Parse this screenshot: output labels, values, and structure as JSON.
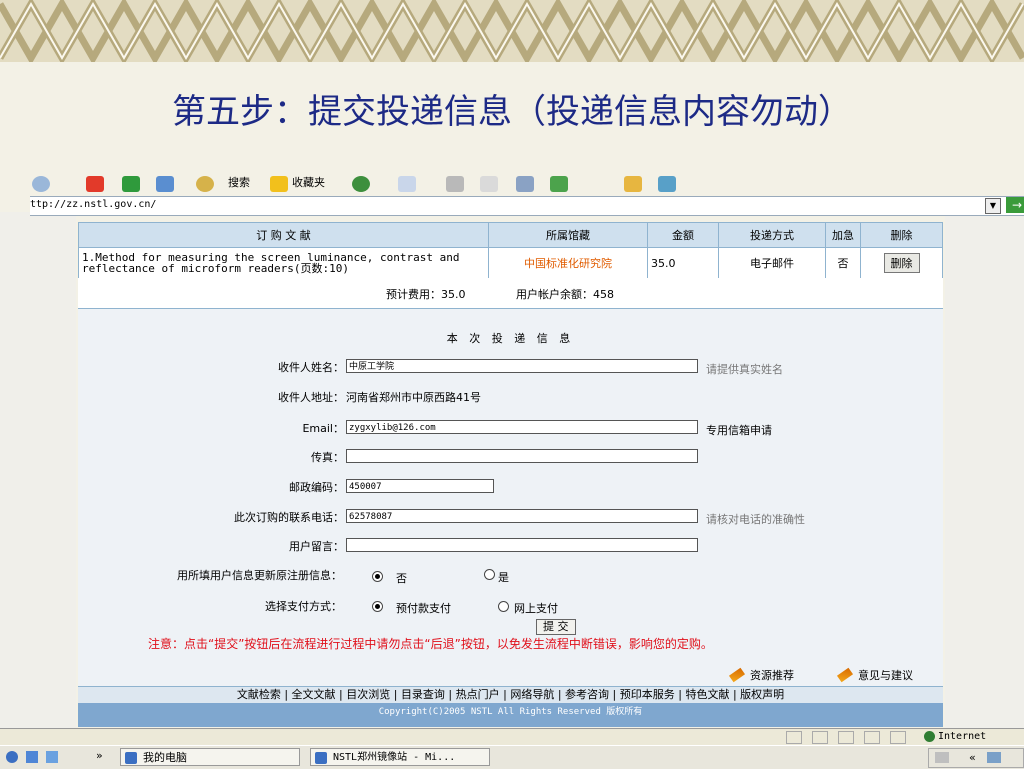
{
  "slide": {
    "title": "第五步：提交投递信息（投递信息内容勿动）"
  },
  "browser": {
    "toolbar": {
      "search": "搜索",
      "favorites": "收藏夹"
    },
    "address": "ttp://zz.nstl.gov.cn/",
    "go_label": "→"
  },
  "order_table": {
    "headers": [
      "订 购 文 献",
      "所属馆藏",
      "金额",
      "投递方式",
      "加急",
      "删除"
    ],
    "row": {
      "title_line1": "1.Method for measuring the screen luminance, contrast and",
      "title_line2": "reflectance of microform readers(页数:10)",
      "library": "中国标准化研究院",
      "amount": "35.0",
      "delivery": "电子邮件",
      "urgent": "否",
      "delete_label": "删除"
    },
    "estimated_cost": "预计费用：35.0",
    "balance": "用户帐户余额：458"
  },
  "delivery_info": {
    "section_title": "本 次 投 递 信 息",
    "recipient_name": {
      "label": "收件人姓名：",
      "value": "中原工学院",
      "hint": "请提供真实姓名"
    },
    "recipient_address": {
      "label": "收件人地址：",
      "value": "河南省郑州市中原西路41号"
    },
    "email": {
      "label": "Email：",
      "value": "zygxylib@126.com",
      "hint": "专用信箱申请"
    },
    "fax": {
      "label": "传真：",
      "value": ""
    },
    "postal_code": {
      "label": "邮政编码：",
      "value": "450007"
    },
    "phone": {
      "label": "此次订购的联系电话：",
      "value": "62578087",
      "hint": "请核对电话的准确性"
    },
    "message": {
      "label": "用户留言：",
      "value": ""
    },
    "update_info": {
      "label": "用所填用户信息更新原注册信息：",
      "option_no": "否",
      "option_yes": "是"
    },
    "payment": {
      "label": "选择支付方式：",
      "option_prepaid": "预付款支付",
      "option_online": "网上支付"
    },
    "submit_label": "提 交",
    "notice": "注意：点击“提交”按钮后在流程进行过程中请勿点击“后退”按钮，以免发生流程中断错误，影响您的定购。"
  },
  "links": {
    "resources": "资源推荐",
    "feedback": "意见与建议"
  },
  "nav": [
    "文献检索",
    "全文文献",
    "目次浏览",
    "目录查询",
    "热点门户",
    "网络导航",
    "参考咨询",
    "预印本服务",
    "特色文献",
    "版权声明"
  ],
  "footer": {
    "copyright": "Copyright(C)2005 NSTL All Rights Reserved 版权所有"
  },
  "statusbar": {
    "zone": "Internet"
  },
  "taskbar": {
    "item1": "我的电脑",
    "item2": "NSTL郑州镜像站 - Mi..."
  },
  "colors": {
    "title": "#1d2a86",
    "notice": "#e0101b",
    "library": "#e05c00",
    "header_bg": "#cfe0ee",
    "footer_bg": "#7fa7cf"
  }
}
